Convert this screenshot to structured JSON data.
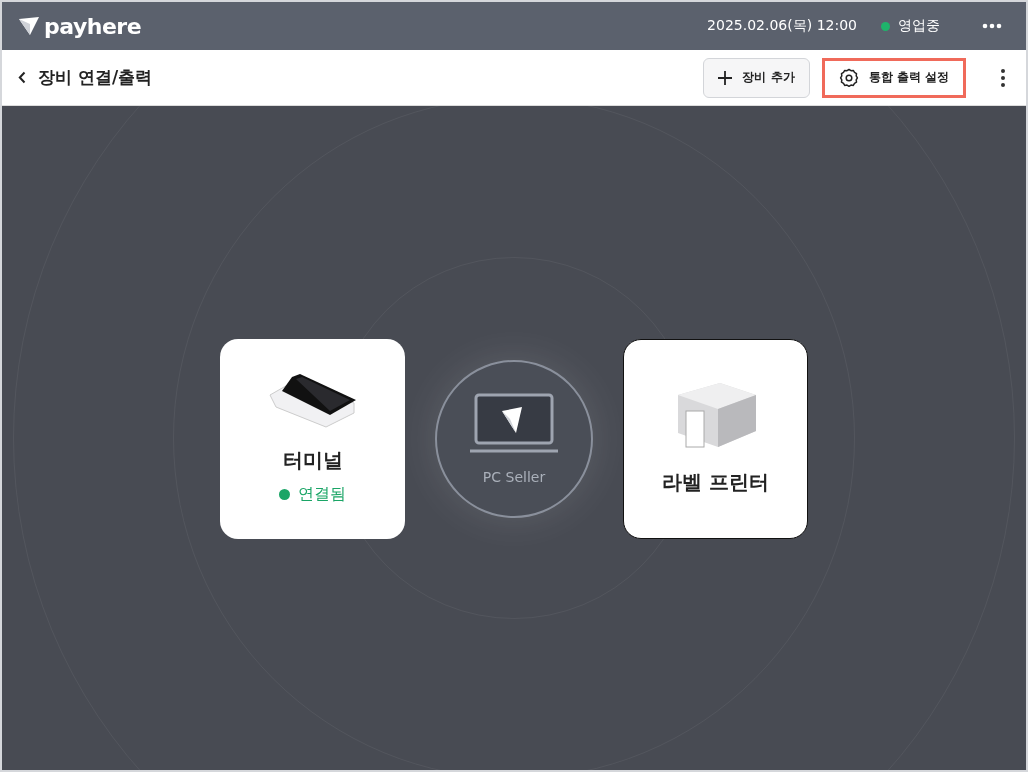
{
  "top_bar": {
    "logo": "payhere",
    "datetime": "2025.02.06(목) 12:00",
    "status": {
      "label": "영업중",
      "color": "#1fb36b"
    }
  },
  "header": {
    "title": "장비 연결/출력",
    "buttons": [
      {
        "kind": "add",
        "label": "장비 추가",
        "highlighted": false
      },
      {
        "kind": "settings",
        "label": "통합 출력 설정",
        "highlighted": true
      }
    ]
  },
  "hub": {
    "label": "PC Seller"
  },
  "devices": [
    {
      "kind": "terminal",
      "name": "터미널",
      "status": "연결됨",
      "selected": false
    },
    {
      "kind": "printer",
      "name": "라벨 프린터",
      "selected": true
    }
  ]
}
